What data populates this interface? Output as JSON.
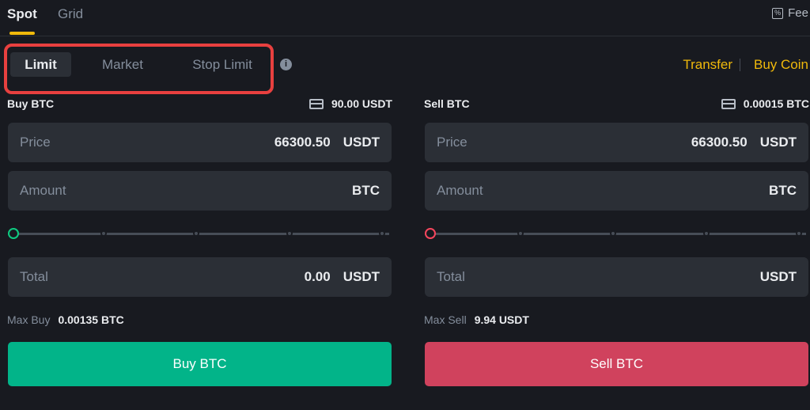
{
  "top_tabs": {
    "spot": "Spot",
    "grid": "Grid",
    "fee": "Fee",
    "fee_icon": "percent-icon"
  },
  "order_types": {
    "limit": "Limit",
    "market": "Market",
    "stop_limit": "Stop Limit",
    "info_icon": "info-icon"
  },
  "links": {
    "transfer": "Transfer",
    "buy_coin": "Buy Coin"
  },
  "buy": {
    "title": "Buy BTC",
    "balance": "90.00 USDT",
    "price_label": "Price",
    "price_value": "66300.50",
    "price_unit": "USDT",
    "amount_label": "Amount",
    "amount_unit": "BTC",
    "total_label": "Total",
    "total_value": "0.00",
    "total_unit": "USDT",
    "max_label": "Max Buy",
    "max_value": "0.00135 BTC",
    "button": "Buy BTC"
  },
  "sell": {
    "title": "Sell BTC",
    "balance": "0.00015 BTC",
    "price_label": "Price",
    "price_value": "66300.50",
    "price_unit": "USDT",
    "amount_label": "Amount",
    "amount_unit": "BTC",
    "total_label": "Total",
    "total_unit": "USDT",
    "max_label": "Max Sell",
    "max_value": "9.94 USDT",
    "button": "Sell BTC"
  },
  "colors": {
    "accent": "#f0b90b",
    "buy": "#02b489",
    "sell": "#d0425d",
    "highlight": "#e8403f"
  }
}
